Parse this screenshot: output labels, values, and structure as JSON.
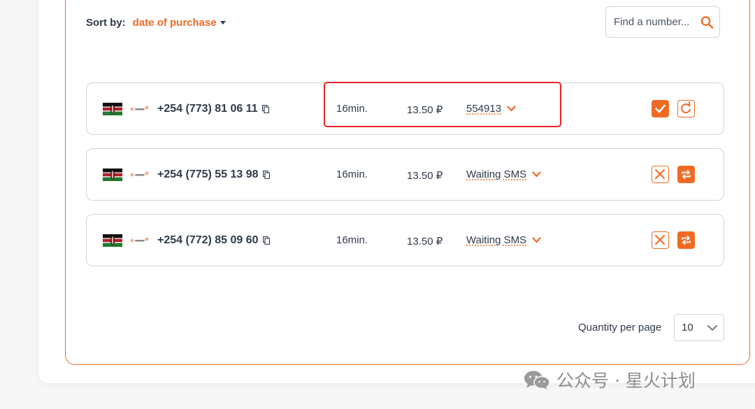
{
  "sort": {
    "label": "Sort by:",
    "value": "date of purchase"
  },
  "search": {
    "placeholder": "Find a number..."
  },
  "colors": {
    "accent": "#f06a23",
    "highlight": "#e8262a"
  },
  "rows": [
    {
      "phone": "+254 (773) 81 06 11",
      "time": "16min.",
      "price": "13.50 ₽",
      "status": "554913",
      "actions": [
        "confirm-check-icon",
        "refresh-icon"
      ]
    },
    {
      "phone": "+254 (775) 55 13 98",
      "time": "16min.",
      "price": "13.50 ₽",
      "status": "Waiting SMS",
      "actions": [
        "cancel-x-icon",
        "swap-icon"
      ]
    },
    {
      "phone": "+254 (772) 85 09 60",
      "time": "16min.",
      "price": "13.50 ₽",
      "status": "Waiting SMS",
      "actions": [
        "cancel-x-icon",
        "swap-icon"
      ]
    }
  ],
  "pagination": {
    "label": "Quantity per page",
    "value": "10"
  },
  "watermark": {
    "text": "公众号 · 星火计划"
  }
}
